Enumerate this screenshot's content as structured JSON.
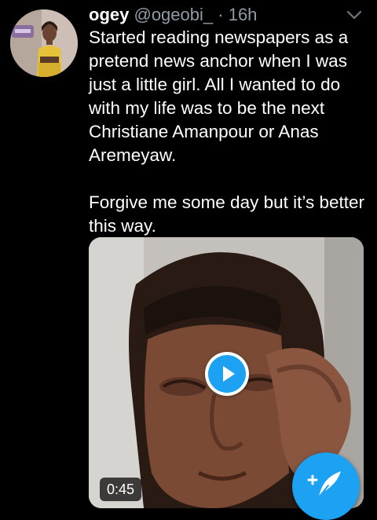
{
  "tweet": {
    "display_name": "ogey",
    "handle": "@ogeobi_",
    "separator": "·",
    "time": "16h",
    "paragraphs": [
      "Started reading newspapers as a pretend news anchor when I was just a little girl. All I wanted to do with my life was to be the next Christiane Amanpour or Anas Aremeyaw.",
      "Forgive me some day but it’s better this way."
    ]
  },
  "media": {
    "type": "video",
    "duration": "0:45",
    "play_icon": "play-icon"
  },
  "icons": {
    "avatar": "avatar",
    "more": "chevron-down-icon",
    "compose": "compose-tweet-icon"
  },
  "colors": {
    "background": "#000000",
    "text_primary": "#ffffff",
    "text_secondary": "#8f9ba6",
    "accent": "#1da1f2"
  }
}
